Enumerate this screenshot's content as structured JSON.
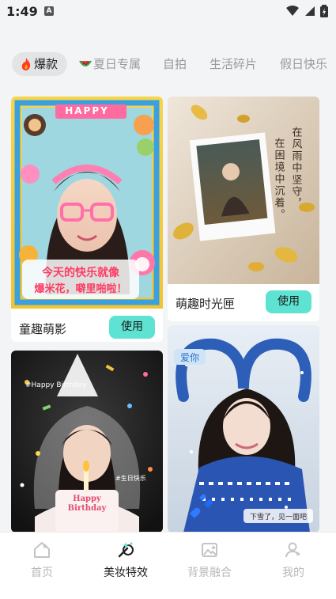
{
  "status_bar": {
    "time": "1:49",
    "badge": "A"
  },
  "tabs": [
    {
      "label": "爆款",
      "active": true,
      "icon": "fire-icon"
    },
    {
      "label": "夏日专属",
      "icon": "watermelon-icon"
    },
    {
      "label": "自拍"
    },
    {
      "label": "生活碎片"
    },
    {
      "label": "假日快乐"
    }
  ],
  "cards": [
    {
      "title": "童趣萌影",
      "use_label": "使用",
      "image_text": {
        "happy": "HAPPY",
        "line1": "今天的快乐就像",
        "line2": "爆米花，噼里啪啦！"
      }
    },
    {
      "title": "萌趣时光匣",
      "use_label": "使用",
      "image_text": {
        "poem_col1": "在风雨中坚守，",
        "poem_col2": "在困境中沉着。"
      }
    },
    {
      "image_text": {
        "top": "#Happy Birthday",
        "cake_line1": "Happy",
        "cake_line2": "Birthday",
        "tag": "#生日快乐"
      }
    },
    {
      "image_text": {
        "badge": "爱你",
        "caption": "下雪了，见一面吧"
      }
    }
  ],
  "bottom_nav": [
    {
      "label": "首页",
      "icon": "home-icon"
    },
    {
      "label": "美妆特效",
      "icon": "magic-wand-icon",
      "active": true
    },
    {
      "label": "背景融合",
      "icon": "image-icon"
    },
    {
      "label": "我的",
      "icon": "user-icon"
    }
  ],
  "colors": {
    "accent": "#5ee3d3",
    "background": "#f3f4f6",
    "tab_active_bg": "#e3e4e6"
  }
}
